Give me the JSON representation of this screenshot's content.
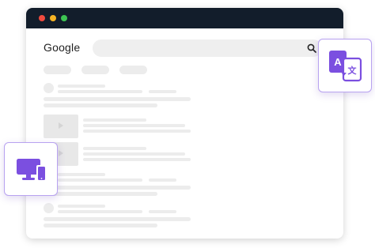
{
  "window": {
    "controls": [
      "close-dot",
      "minimize-dot",
      "maximize-dot"
    ],
    "titlebar_color": "#121d2b"
  },
  "header": {
    "brand": "Google",
    "search": {
      "value": "",
      "icon": "search-icon"
    }
  },
  "floating_cards": [
    {
      "icon": "translate-icon",
      "color": "#7b4fe0"
    },
    {
      "icon": "devices-icon",
      "color": "#7b4fe0"
    }
  ],
  "accent_color": "#7b4fe0"
}
